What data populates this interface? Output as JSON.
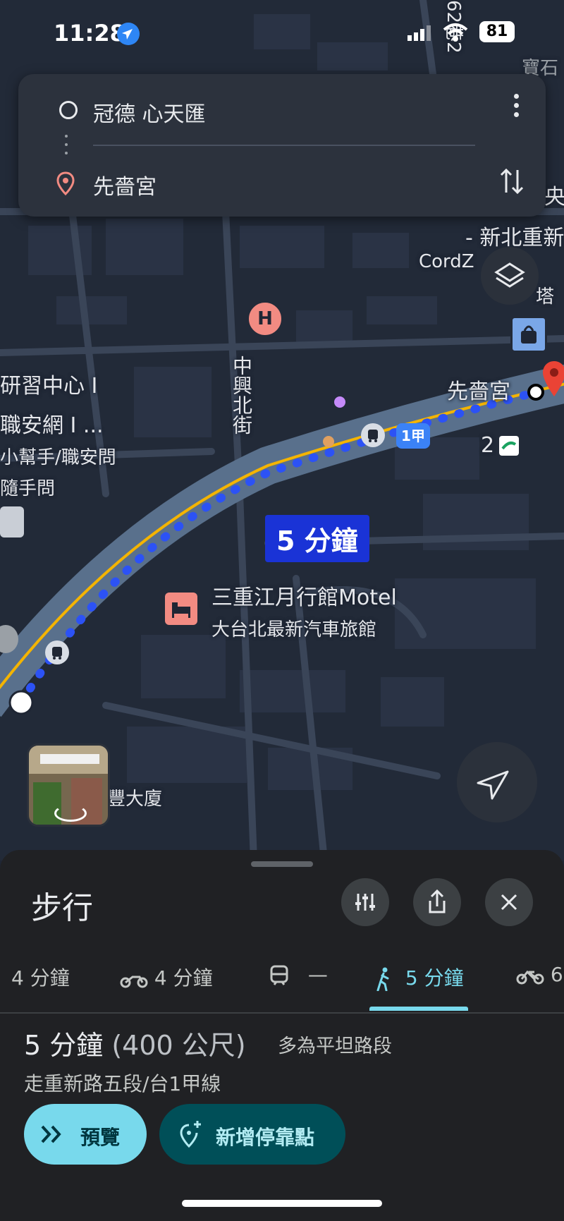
{
  "status_bar": {
    "time": "11:28",
    "battery": "81"
  },
  "directions": {
    "origin": "冠德 心天匯",
    "destination": "先嗇宮"
  },
  "map": {
    "route_time_label": "5 分鐘",
    "labels": {
      "training_center_1": "研習中心 I",
      "training_center_2": "職安網 I ...",
      "training_center_3": "小幫手/職安問",
      "training_center_4": "隨手問",
      "street_zhongxing": "中興北街",
      "motel_name": "三重江月行館Motel",
      "motel_sub": "大台北最新汽車旅館",
      "xiansegong": "先嗇宮",
      "new_taipei": "- 新北重新",
      "cordz": "CordZ",
      "tower": "塔",
      "route_1jia": "1甲",
      "road_62": "62巷2",
      "baoshi": "寶石",
      "yang": "央",
      "fengda": "豐大廈",
      "bus_num": "2"
    }
  },
  "sheet": {
    "title": "步行",
    "modes": [
      {
        "label": "4 分鐘",
        "icon": "car-icon"
      },
      {
        "label": "4 分鐘",
        "icon": "motorcycle-icon"
      },
      {
        "label": "—",
        "icon": "transit-icon"
      },
      {
        "label": "5 分鐘",
        "icon": "walk-icon"
      },
      {
        "label": "6",
        "icon": "bike-icon"
      }
    ],
    "summary_time": "5 分鐘",
    "summary_distance": "(400 公尺)",
    "summary_desc": "多為平坦路段",
    "summary_route": "走重新路五段/台1甲線",
    "preview_label": "預覽",
    "add_stop_label": "新增停靠點"
  },
  "colors": {
    "accent": "#78d9ec",
    "route_dot": "#2c52f5",
    "route_line": "#f4b400",
    "pin": "#ea4335"
  }
}
